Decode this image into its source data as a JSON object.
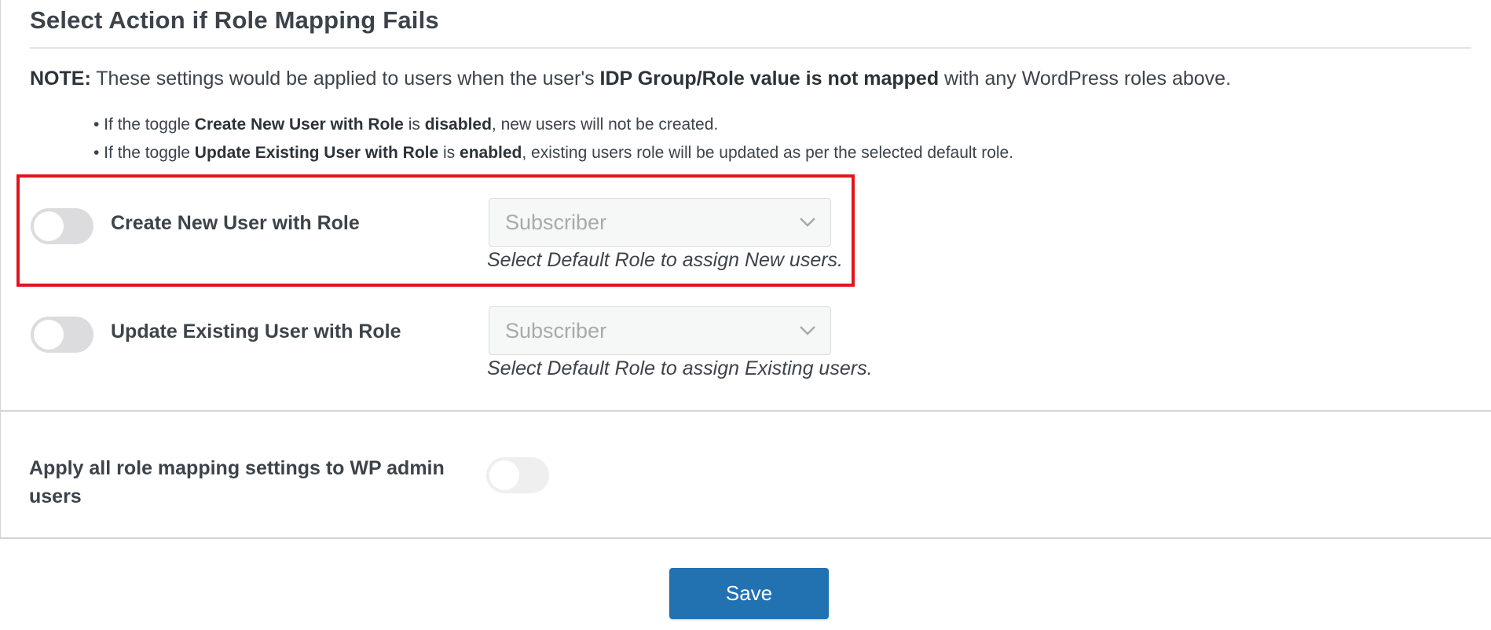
{
  "section": {
    "title": "Select Action if Role Mapping Fails"
  },
  "note": {
    "prefix": "NOTE:",
    "text_1": " These settings would be applied to users when the user's ",
    "bold_1": "IDP Group/Role value is not mapped",
    "text_2": " with any WordPress roles above."
  },
  "bullets": [
    {
      "t1": "• If the toggle ",
      "b1": "Create New User with Role",
      "t2": " is ",
      "b2": "disabled",
      "t3": ", new users will not be created."
    },
    {
      "t1": "• If the toggle ",
      "b1": "Update Existing User with Role",
      "t2": " is ",
      "b2": "enabled",
      "t3": ", existing users role will be updated as per the selected default role."
    }
  ],
  "create_new_user": {
    "label": "Create New User with Role",
    "enabled": false,
    "selected_role": "Subscriber",
    "hint": "Select Default Role to assign New users."
  },
  "update_existing_user": {
    "label": "Update Existing User with Role",
    "enabled": false,
    "selected_role": "Subscriber",
    "hint": "Select Default Role to assign Existing users."
  },
  "apply_admin": {
    "label": "Apply all role mapping settings to WP admin users",
    "enabled": false
  },
  "actions": {
    "save_label": "Save"
  },
  "colors": {
    "highlight": "#e3141b",
    "primary_button": "#2271b1",
    "toggle_off": "#dcdcde"
  },
  "icons": {
    "dropdown": "chevron-down-icon"
  }
}
